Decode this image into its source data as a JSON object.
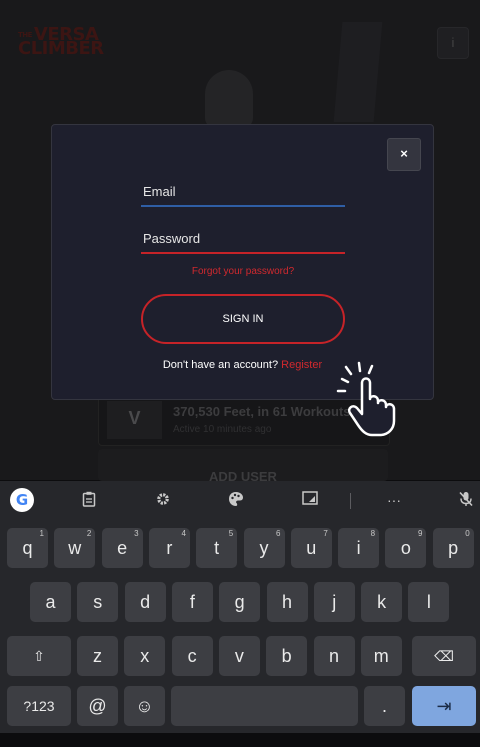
{
  "background_app": {
    "logo_small": "THE",
    "logo_line1": "VERSA",
    "logo_line2": "CLIMBER",
    "info_label": "i",
    "card_tile": "V",
    "card_title": "370,530 Feet, in 61 Workouts",
    "card_subtitle": "Active 10 minutes ago",
    "add_user_label": "ADD USER"
  },
  "login_modal": {
    "close_label": "×",
    "email_placeholder": "Email",
    "password_placeholder": "Password",
    "forgot_link": "Forgot your password?",
    "signin_label": "SIGN IN",
    "no_account_text": "Don't have an account?",
    "register_link": "Register"
  },
  "keyboard": {
    "toolbar_icons": [
      "google-icon",
      "clipboard-icon",
      "settings-icon",
      "theme-icon",
      "resize-icon",
      "more-icon",
      "mic-off-icon"
    ],
    "row1": [
      {
        "k": "q",
        "s": "1"
      },
      {
        "k": "w",
        "s": "2"
      },
      {
        "k": "e",
        "s": "3"
      },
      {
        "k": "r",
        "s": "4"
      },
      {
        "k": "t",
        "s": "5"
      },
      {
        "k": "y",
        "s": "6"
      },
      {
        "k": "u",
        "s": "7"
      },
      {
        "k": "i",
        "s": "8"
      },
      {
        "k": "o",
        "s": "9"
      },
      {
        "k": "p",
        "s": "0"
      }
    ],
    "row2": [
      "a",
      "s",
      "d",
      "f",
      "g",
      "h",
      "j",
      "k",
      "l"
    ],
    "row3": [
      "z",
      "x",
      "c",
      "v",
      "b",
      "n",
      "m"
    ],
    "shift_glyph": "⇧",
    "backspace_glyph": "⌫",
    "symbols_label": "?123",
    "at_label": "@",
    "emoji_glyph": "☺",
    "period_label": ".",
    "enter_glyph": "⇥",
    "colors": {
      "key": "#3d3e43",
      "enter": "#7fa6df",
      "background": "#26272b"
    }
  },
  "colors": {
    "accent_red": "#c62328",
    "focus_blue": "#2f5ea5",
    "modal_bg": "#1e1f2d"
  }
}
